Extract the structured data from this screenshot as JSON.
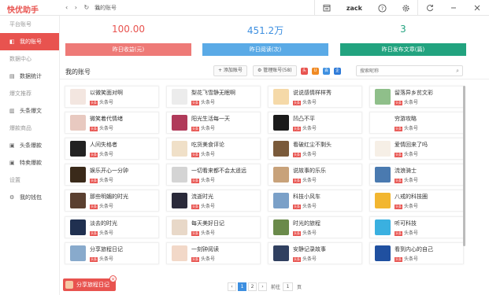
{
  "titlebar": {
    "brand": "快优助手",
    "nav": "‹ › ↻ ⌂",
    "breadcrumb": "我的账号",
    "username": "zack",
    "icons": [
      "calendar-icon",
      "help-icon",
      "settings-icon",
      "refresh-icon",
      "minimize-icon",
      "close-icon"
    ]
  },
  "sidebar": [
    {
      "kind": "section",
      "label": "平台账号"
    },
    {
      "kind": "item",
      "label": "我的账号",
      "icon": "◧",
      "active": true
    },
    {
      "kind": "section",
      "label": "数据中心"
    },
    {
      "kind": "item",
      "label": "数据统计",
      "icon": "▤",
      "active": false
    },
    {
      "kind": "section",
      "label": "爆文推荐"
    },
    {
      "kind": "item",
      "label": "头条爆文",
      "icon": "▥",
      "active": false
    },
    {
      "kind": "section",
      "label": "爆款商品"
    },
    {
      "kind": "item",
      "label": "头条爆款",
      "icon": "▣",
      "active": false
    },
    {
      "kind": "item",
      "label": "特卖爆款",
      "icon": "▣",
      "active": false
    },
    {
      "kind": "section",
      "label": "设置"
    },
    {
      "kind": "item",
      "label": "我的钱包",
      "icon": "⚙",
      "active": false
    }
  ],
  "stats": [
    {
      "value": "100.00",
      "label": "昨日收益(元)",
      "color": "#e8534f",
      "bar": "#ee7a77"
    },
    {
      "value": "451.2万",
      "label": "昨日阅读(次)",
      "color": "#3d8fe0",
      "bar": "#5aaae6"
    },
    {
      "value": "3",
      "label": "昨日发布文章(篇)",
      "color": "#22a37f",
      "bar": "#22a37f"
    }
  ],
  "panel": {
    "title": "我的账号",
    "add_button": "+ 添加账号",
    "manage_button": "管理账号(58)",
    "search_placeholder": "搜索昵称",
    "platforms": [
      {
        "name": "toutiao-platform-icon",
        "label": "头",
        "color": "#e8534f"
      },
      {
        "name": "uc-platform-icon",
        "label": "U",
        "color": "#f08a24"
      },
      {
        "name": "baijia-platform-icon",
        "label": "百",
        "color": "#3d8fe0"
      },
      {
        "name": "qq-platform-icon",
        "label": "企",
        "color": "#2f7bd8"
      }
    ]
  },
  "tag_badge": "头条",
  "accounts": [
    {
      "name": "以微笑面对啊",
      "platform": "头条号",
      "avatar": "#f3e6e0"
    },
    {
      "name": "梨花飞雪静无眠啊",
      "platform": "头条号",
      "avatar": "#ececec"
    },
    {
      "name": "说说感情样样秀",
      "platform": "头条号",
      "avatar": "#f5d9a8"
    },
    {
      "name": "留落异乡贫文彩",
      "platform": "头条号",
      "avatar": "#8fbf8a"
    },
    {
      "name": "微笑着代情绪",
      "platform": "头条号",
      "avatar": "#e8c9c0"
    },
    {
      "name": "阳光生活每一天",
      "platform": "头条号",
      "avatar": "#b03a5a"
    },
    {
      "name": "凹凸不平",
      "platform": "头条号",
      "avatar": "#1a1a1a"
    },
    {
      "name": "穷游攻略",
      "platform": "头条号",
      "avatar": "#ffffff"
    },
    {
      "name": "人间失格者",
      "platform": "头条号",
      "avatar": "#222222"
    },
    {
      "name": "吃货美食评论",
      "platform": "头条号",
      "avatar": "#f0e0c8"
    },
    {
      "name": "看破红尘不剩头",
      "platform": "头条号",
      "avatar": "#7a5a3a"
    },
    {
      "name": "爱情回来了吗",
      "platform": "头条号",
      "avatar": "#f6efe6"
    },
    {
      "name": "娱乐开心一分钟",
      "platform": "头条号",
      "avatar": "#3a2a1a"
    },
    {
      "name": "一切看来都不会太遥远",
      "platform": "头条号",
      "avatar": "#d4d4d4"
    },
    {
      "name": "说故事的乐乐",
      "platform": "头条号",
      "avatar": "#c8a27a"
    },
    {
      "name": "流浪骑士",
      "platform": "头条号",
      "avatar": "#4a7ab0"
    },
    {
      "name": "那些明媚的时光",
      "platform": "头条号",
      "avatar": "#5a4030"
    },
    {
      "name": "流逝时光",
      "platform": "头条号",
      "avatar": "#2a2a3a"
    },
    {
      "name": "科技小风车",
      "platform": "头条号",
      "avatar": "#7aa0c8"
    },
    {
      "name": "八戒的科技圈",
      "platform": "头条号",
      "avatar": "#f2b630"
    },
    {
      "name": "淡去的时光",
      "platform": "头条号",
      "avatar": "#203050"
    },
    {
      "name": "每天美好日记",
      "platform": "头条号",
      "avatar": "#e8d8c8"
    },
    {
      "name": "时光的旅程",
      "platform": "头条号",
      "avatar": "#6a8a4a"
    },
    {
      "name": "听可科技",
      "platform": "头条号",
      "avatar": "#3ab0e0"
    },
    {
      "name": "分享旅程日记",
      "platform": "头条号",
      "avatar": "#88aacc"
    },
    {
      "name": "一刻钟阅读",
      "platform": "头条号",
      "avatar": "#f2d8c8"
    },
    {
      "name": "安静记录故事",
      "platform": "头条号",
      "avatar": "#304060"
    },
    {
      "name": "看到内心的自己",
      "platform": "头条号",
      "avatar": "#2050a0"
    }
  ],
  "pagination": {
    "prev": "‹",
    "pages": [
      "1",
      "2"
    ],
    "current": "1",
    "next": "›",
    "goto_label": "前往",
    "goto_value": "1",
    "page_suffix": "页"
  },
  "open_tab": {
    "label": "分享旅程日记",
    "close": "×"
  }
}
